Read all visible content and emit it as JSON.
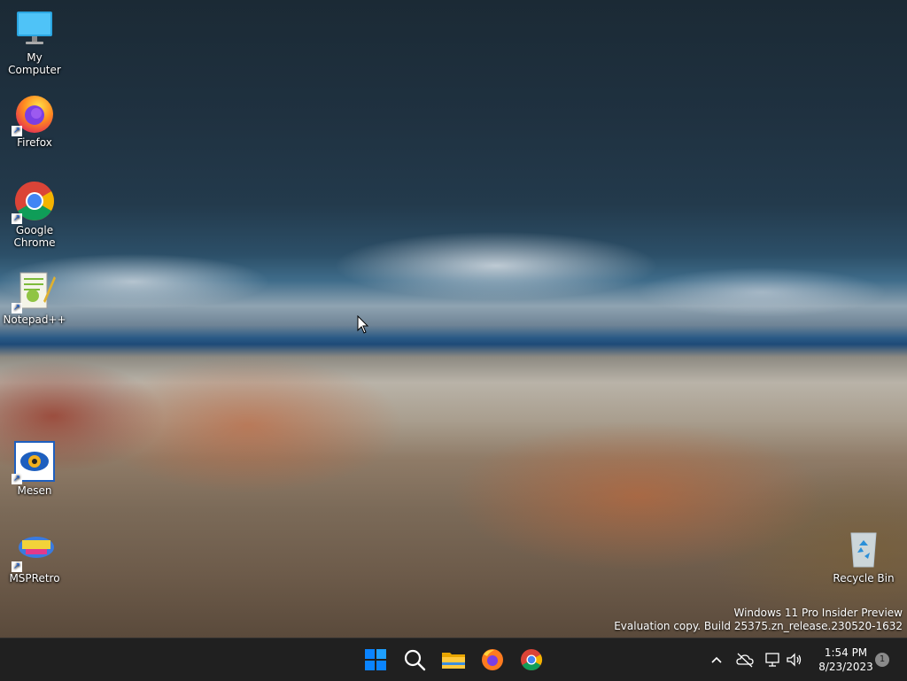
{
  "desktop": {
    "icons": [
      {
        "label": "My Computer"
      },
      {
        "label": "Firefox"
      },
      {
        "label": "Google Chrome"
      },
      {
        "label": "Notepad++"
      },
      {
        "label": "Mesen"
      },
      {
        "label": "MSPRetro"
      },
      {
        "label": "Recycle Bin"
      }
    ]
  },
  "watermark": {
    "line1": "Windows 11 Pro Insider Preview",
    "line2": "Evaluation copy. Build 25375.zn_release.230520-1632"
  },
  "taskbar": {
    "pinned": [
      "start-icon",
      "search-icon",
      "file-explorer-icon",
      "firefox-icon",
      "chrome-icon"
    ],
    "clock": {
      "time": "1:54 PM",
      "date": "8/23/2023"
    },
    "notification_count": "1"
  },
  "colors": {
    "taskbar": "#202020",
    "start_blue": "#0078d4"
  }
}
